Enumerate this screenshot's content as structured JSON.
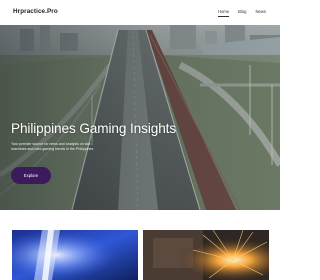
{
  "site": {
    "name": "Hrpractice.Pro"
  },
  "nav": {
    "items": [
      {
        "label": "Home",
        "active": true
      },
      {
        "label": "Blog",
        "active": false
      },
      {
        "label": "News",
        "active": false
      }
    ]
  },
  "hero": {
    "title": "Philippines Gaming Insights",
    "subtitle": "Your premier source for news and analysis on slot machines and card gaming trends in the Philippines",
    "cta_label": "Explore",
    "cta_color": "#3b1a5e"
  },
  "cards": [
    {
      "image": "blue-light-abstract-image"
    },
    {
      "image": "sparks-machinery-image"
    }
  ]
}
